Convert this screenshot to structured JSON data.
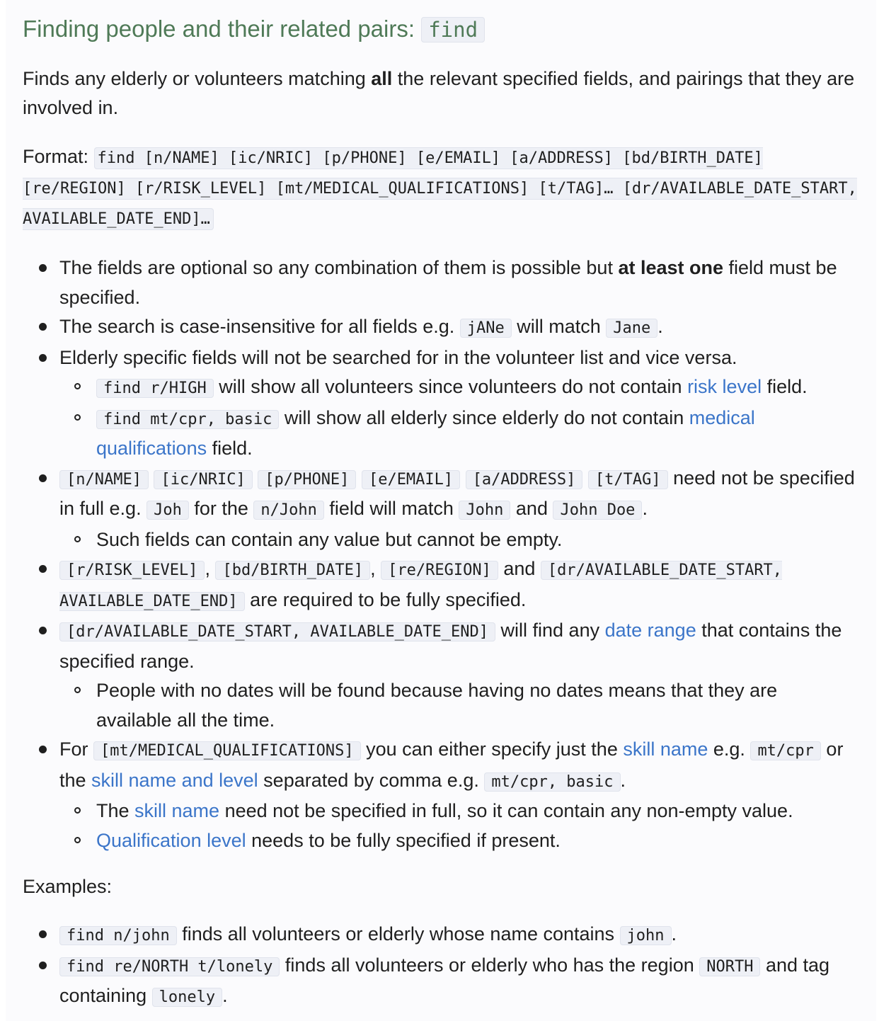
{
  "heading": {
    "text": "Finding people and their related pairs: ",
    "code": "find"
  },
  "intro": {
    "t1": "Finds any elderly or volunteers matching ",
    "bold": "all",
    "t2": " the relevant specified fields, and pairings that they are involved in."
  },
  "format": {
    "label": "Format: ",
    "code": "find [n/NAME] [ic/NRIC] [p/PHONE] [e/EMAIL] [a/ADDRESS] [bd/BIRTH_DATE] [re/REGION] [r/RISK_LEVEL] [mt/MEDICAL_QUALIFICATIONS] [t/TAG]… [dr/AVAILABLE_DATE_START, AVAILABLE_DATE_END]…"
  },
  "bullets": {
    "b1": {
      "t1": "The fields are optional so any combination of them is possible but ",
      "bold": "at least one",
      "t2": " field must be specified."
    },
    "b2": {
      "t1": "The search is case-insensitive for all fields e.g. ",
      "c1": "jANe",
      "t2": " will match ",
      "c2": "Jane",
      "t3": "."
    },
    "b3": {
      "t1": "Elderly specific fields will not be searched for in the volunteer list and vice versa.",
      "s1": {
        "c1": "find r/HIGH",
        "t1": " will show all volunteers since volunteers do not contain ",
        "link": "risk level",
        "t2": " field."
      },
      "s2": {
        "c1": "find mt/cpr, basic",
        "t1": " will show all elderly since elderly do not contain ",
        "link": "medical qualifications",
        "t2": " field."
      }
    },
    "b4": {
      "c1": "[n/NAME]",
      "c2": "[ic/NRIC]",
      "c3": "[p/PHONE]",
      "c4": "[e/EMAIL]",
      "c5": "[a/ADDRESS]",
      "c6": "[t/TAG]",
      "t1": " need not be specified in full e.g. ",
      "c7": "Joh",
      "t2": " for the ",
      "c8": "n/John",
      "t3": " field will match ",
      "c9": "John",
      "t4": " and ",
      "c10": "John Doe",
      "t5": ".",
      "s1": "Such fields can contain any value but cannot be empty."
    },
    "b5": {
      "c1": "[r/RISK_LEVEL]",
      "sep1": ", ",
      "c2": "[bd/BIRTH_DATE]",
      "sep2": ", ",
      "c3": "[re/REGION]",
      "t1": " and ",
      "c4": "[dr/AVAILABLE_DATE_START, AVAILABLE_DATE_END]",
      "t2": " are required to be fully specified."
    },
    "b6": {
      "c1": "[dr/AVAILABLE_DATE_START, AVAILABLE_DATE_END]",
      "t1": " will find any ",
      "link": "date range",
      "t2": " that contains the specified range.",
      "s1": "People with no dates will be found because having no dates means that they are available all the time."
    },
    "b7": {
      "t0": "For ",
      "c1": "[mt/MEDICAL_QUALIFICATIONS]",
      "t1": " you can either specify just the ",
      "link1": "skill name",
      "t2": " e.g. ",
      "c2": "mt/cpr",
      "t3": " or the ",
      "link2": "skill name and level",
      "t4": " separated by comma e.g. ",
      "c3": "mt/cpr, basic",
      "t5": ".",
      "s1": {
        "t1": "The ",
        "link": "skill name",
        "t2": " need not be specified in full, so it can contain any non-empty value."
      },
      "s2": {
        "link": "Qualification level",
        "t1": " needs to be fully specified if present."
      }
    }
  },
  "examples": {
    "title": "Examples:",
    "e1": {
      "c1": "find n/john",
      "t1": " finds all volunteers or elderly whose name contains ",
      "c2": "john",
      "t2": "."
    },
    "e2": {
      "c1": "find re/NORTH t/lonely",
      "t1": " finds all volunteers or elderly who has the region ",
      "c2": "NORTH",
      "t2": " and tag containing ",
      "c3": "lonely",
      "t3": "."
    }
  }
}
